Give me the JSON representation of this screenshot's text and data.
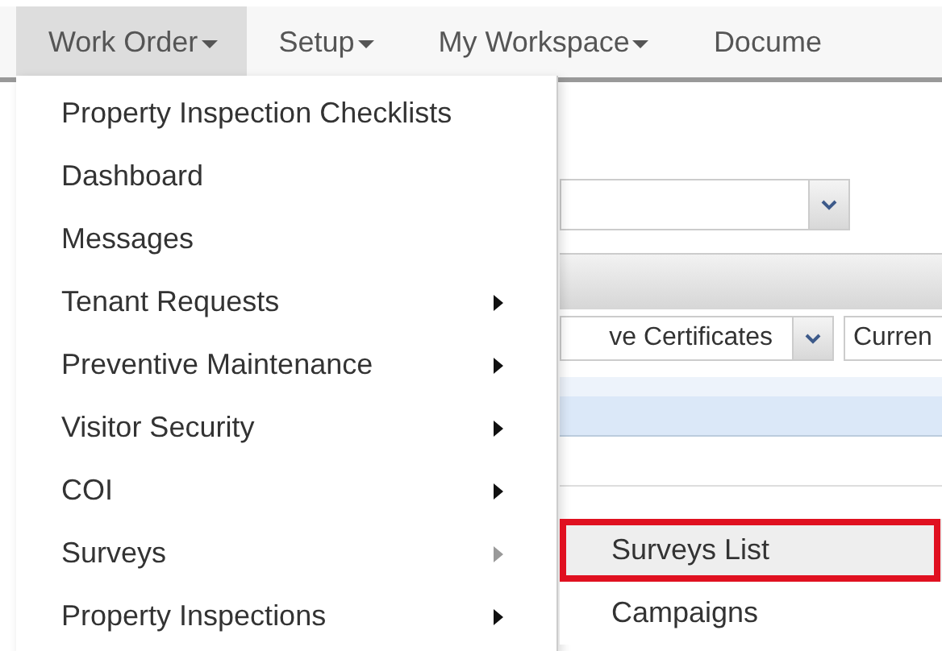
{
  "nav": [
    {
      "label": "Work Order",
      "selected": true,
      "caret": true
    },
    {
      "label": "Setup",
      "selected": false,
      "caret": true
    },
    {
      "label": "My Workspace",
      "selected": false,
      "caret": true
    },
    {
      "label": "Docume",
      "selected": false,
      "caret": false
    }
  ],
  "menu": [
    {
      "label": "Property Inspection Checklists",
      "submenu": false
    },
    {
      "label": "Dashboard",
      "submenu": false
    },
    {
      "label": "Messages",
      "submenu": false
    },
    {
      "label": "Tenant Requests",
      "submenu": true,
      "expanded": false
    },
    {
      "label": "Preventive Maintenance",
      "submenu": true,
      "expanded": false
    },
    {
      "label": "Visitor Security",
      "submenu": true,
      "expanded": false
    },
    {
      "label": "COI",
      "submenu": true,
      "expanded": false
    },
    {
      "label": "Surveys",
      "submenu": true,
      "expanded": true
    },
    {
      "label": "Property Inspections",
      "submenu": true,
      "expanded": false
    }
  ],
  "submenu": [
    {
      "label": "Surveys List",
      "selected": true,
      "callout": true
    },
    {
      "label": "Campaigns",
      "selected": false,
      "callout": false
    }
  ],
  "background": {
    "filter_value": "ve Certificates",
    "field_value": "Curren"
  }
}
